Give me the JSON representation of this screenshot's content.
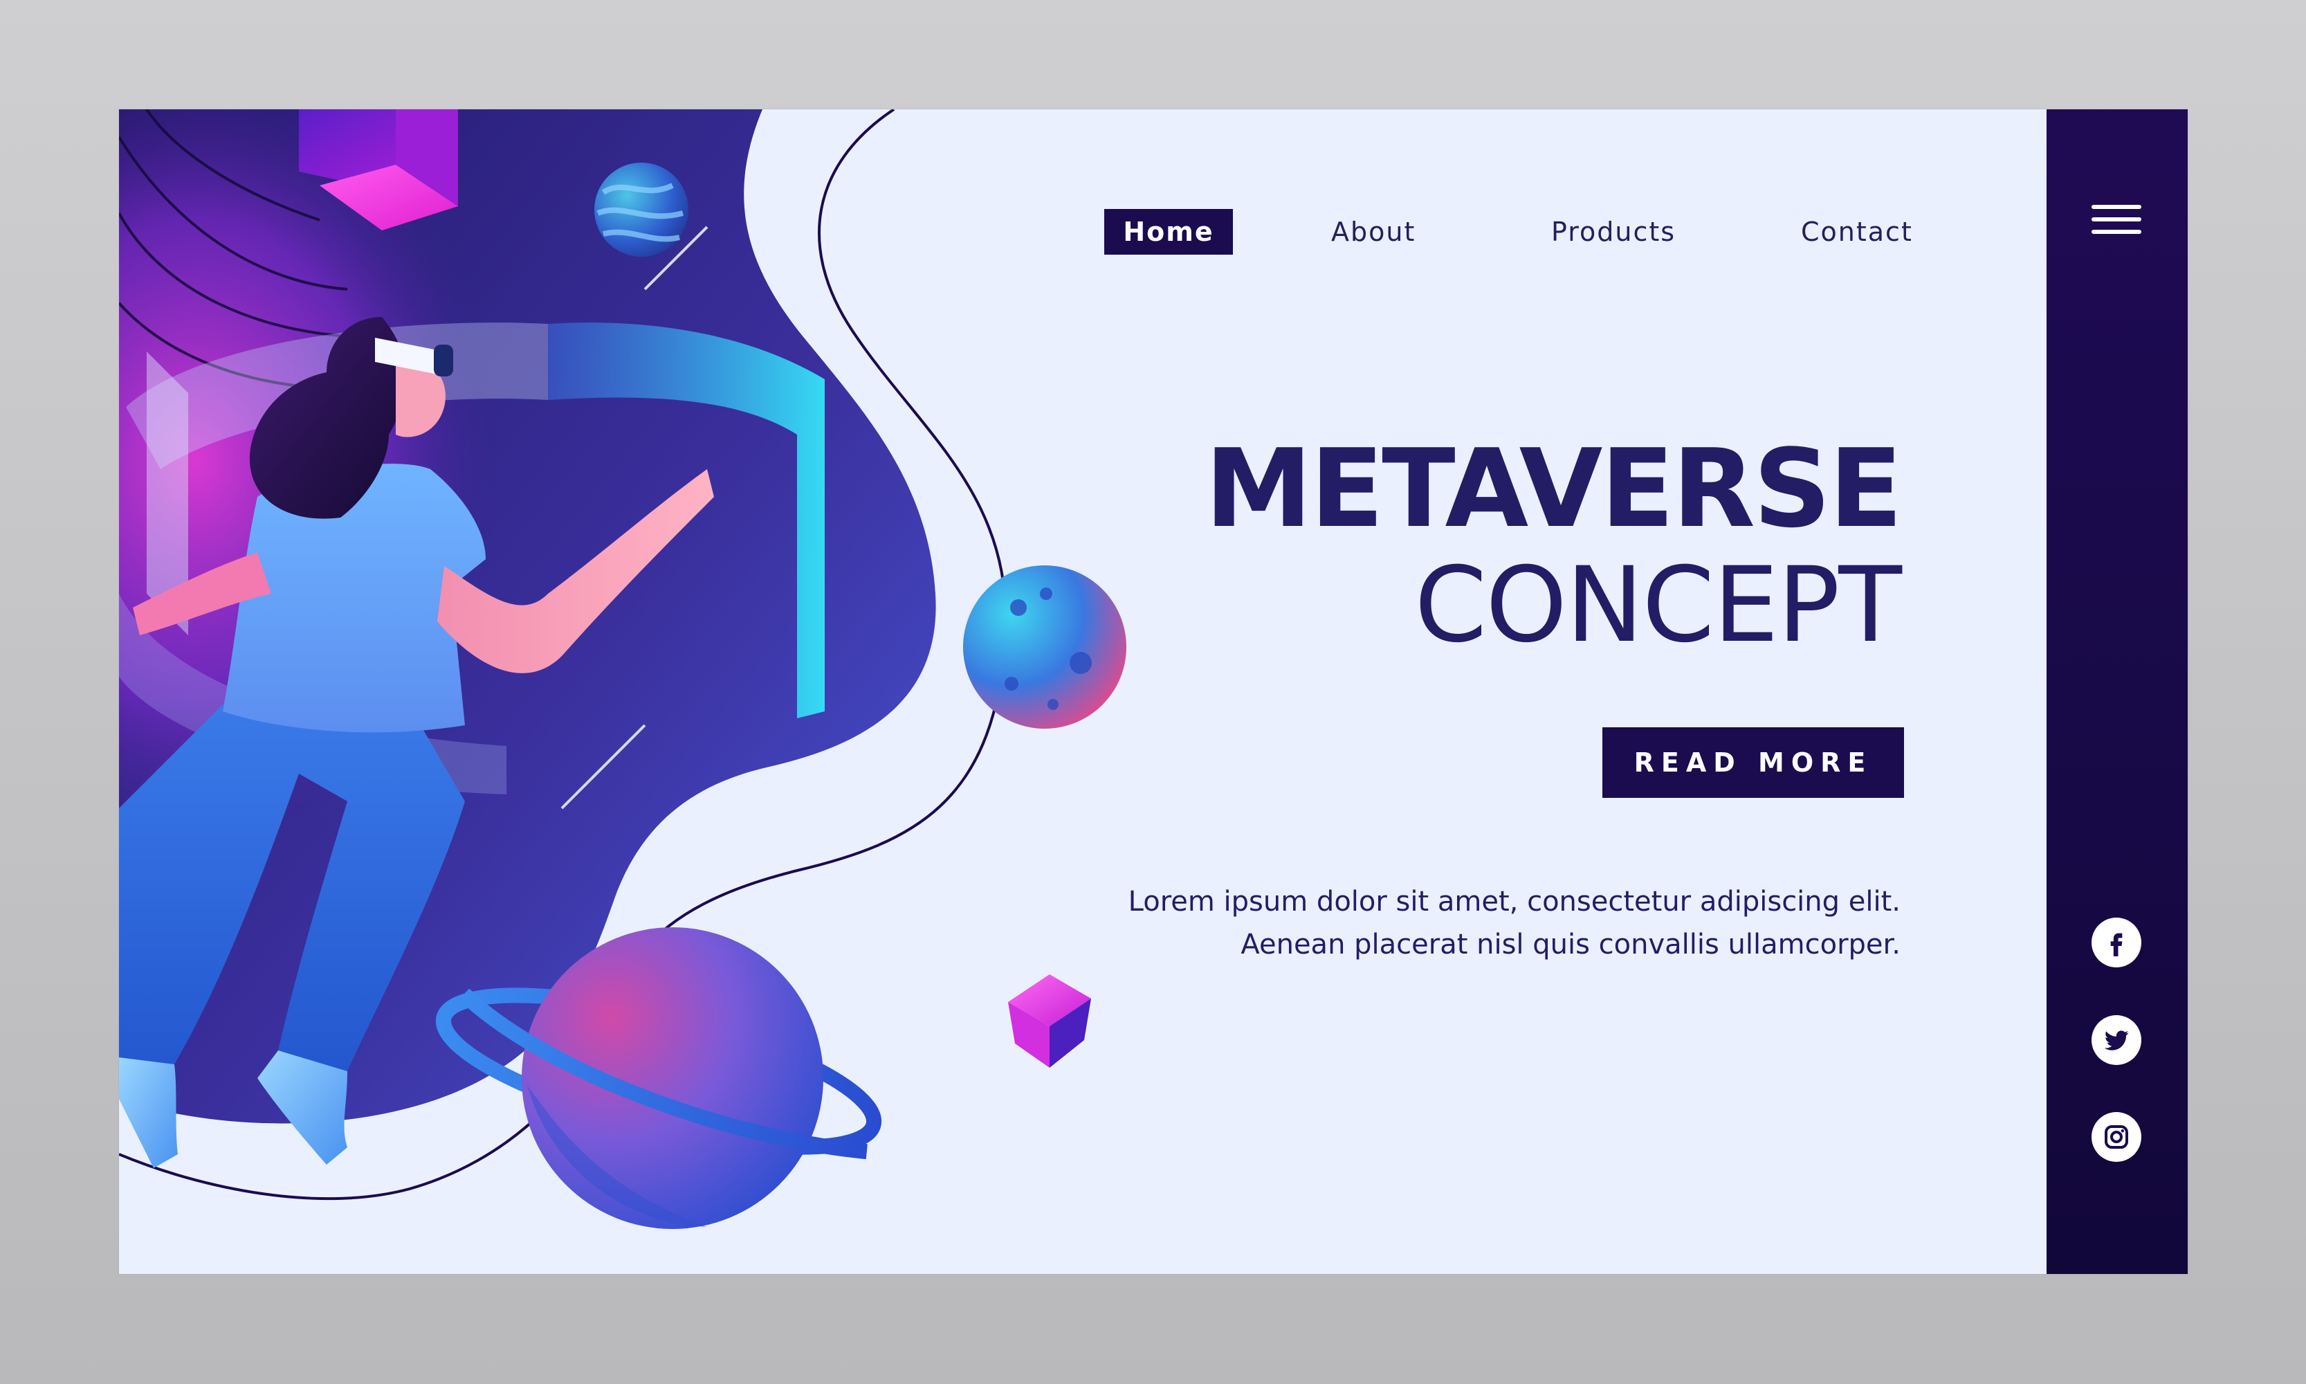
{
  "nav": {
    "items": [
      {
        "label": "Home",
        "active": true
      },
      {
        "label": "About",
        "active": false
      },
      {
        "label": "Products",
        "active": false
      },
      {
        "label": "Contact",
        "active": false
      }
    ]
  },
  "hero": {
    "title_line1": "METAVERSE",
    "title_line2": "CONCEPT",
    "cta_label": "READ MORE",
    "description": [
      "Lorem ipsum dolor sit amet, consectetur adipiscing elit.",
      "Aenean placerat nisl quis convallis ullamcorper."
    ]
  },
  "sidebar": {
    "menu_icon": "hamburger-menu-icon",
    "social": [
      {
        "icon": "facebook-icon"
      },
      {
        "icon": "twitter-icon"
      },
      {
        "icon": "instagram-icon"
      }
    ]
  },
  "colors": {
    "navy": "#1b0b4f",
    "title": "#231d65",
    "page_bg": "#eaf0fd",
    "purple": "#7a2bd8",
    "magenta": "#e23ad6",
    "blue": "#2f5fd8",
    "cyan": "#35d6f0",
    "pink_skin": "#f7a2b9"
  }
}
